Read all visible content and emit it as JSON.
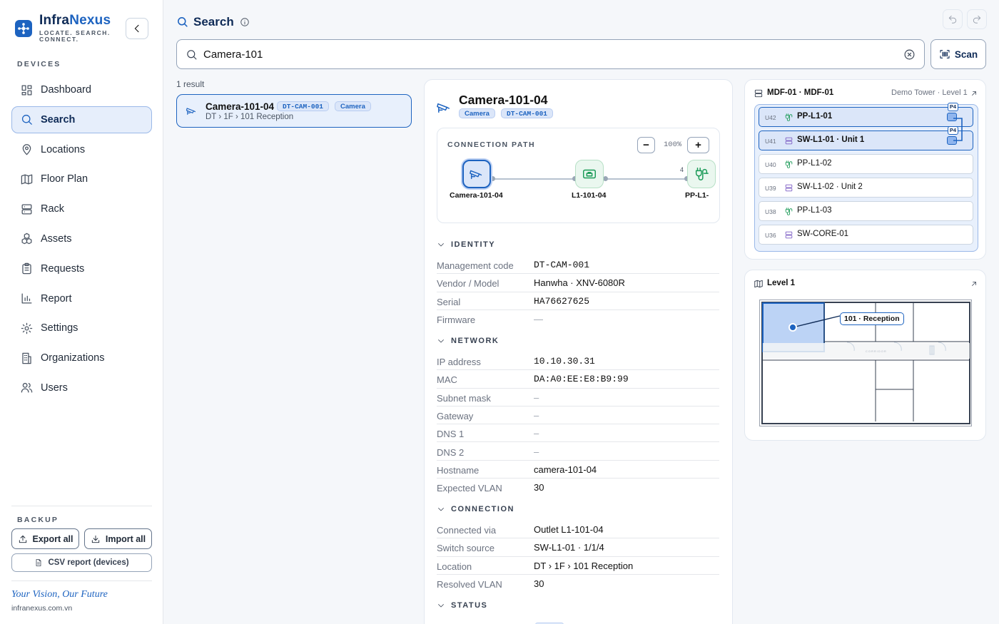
{
  "brand": {
    "name_a": "Infra",
    "name_b": "Nexus",
    "tagline": "LOCATE. SEARCH. CONNECT."
  },
  "sidebar": {
    "section": "DEVICES",
    "items": [
      {
        "label": "Dashboard",
        "icon": "dashboard-icon"
      },
      {
        "label": "Search",
        "icon": "search-icon",
        "active": true
      },
      {
        "label": "Locations",
        "icon": "map-pin-icon"
      },
      {
        "label": "Floor Plan",
        "icon": "map-icon"
      },
      {
        "label": "Rack",
        "icon": "server-icon"
      },
      {
        "label": "Assets",
        "icon": "boxes-icon"
      },
      {
        "label": "Requests",
        "icon": "clipboard-icon"
      },
      {
        "label": "Report",
        "icon": "bar-chart-icon"
      },
      {
        "label": "Settings",
        "icon": "gear-icon"
      },
      {
        "label": "Organizations",
        "icon": "building-icon"
      },
      {
        "label": "Users",
        "icon": "users-icon"
      }
    ],
    "backup": {
      "label": "BACKUP",
      "export": "Export all",
      "import": "Import all",
      "csv": "CSV report (devices)"
    },
    "slogan": "Your Vision, Our Future",
    "site": "infranexus.com.vn"
  },
  "header": {
    "title": "Search"
  },
  "search": {
    "value": "Camera-101",
    "scan_label": "Scan"
  },
  "results": {
    "count": "1 result",
    "items": [
      {
        "name": "Camera-101-04",
        "code": "DT-CAM-001",
        "type": "Camera",
        "path": "DT › 1F › 101 Reception"
      }
    ]
  },
  "detail": {
    "title": "Camera-101-04",
    "type_chip": "Camera",
    "code_chip": "DT-CAM-001",
    "connection_path": {
      "label": "CONNECTION PATH",
      "zoom": "100%",
      "nodes": [
        "Camera-101-04",
        "L1-101-04",
        "PP-L1-"
      ],
      "port_label": "4"
    },
    "identity": {
      "label": "IDENTITY",
      "rows": [
        {
          "k": "Management code",
          "v": "DT-CAM-001",
          "mono": true
        },
        {
          "k": "Vendor / Model",
          "v": "Hanwha · XNV-6080R"
        },
        {
          "k": "Serial",
          "v": "HA76627625",
          "mono": true
        },
        {
          "k": "Firmware",
          "v": "—",
          "dim": true
        }
      ]
    },
    "network": {
      "label": "NETWORK",
      "rows": [
        {
          "k": "IP address",
          "v": "10.10.30.31",
          "mono": true
        },
        {
          "k": "MAC",
          "v": "DA:A0:EE:E8:B9:99",
          "mono": true
        },
        {
          "k": "Subnet mask",
          "v": "–",
          "dim": true
        },
        {
          "k": "Gateway",
          "v": "–",
          "dim": true
        },
        {
          "k": "DNS 1",
          "v": "–",
          "dim": true
        },
        {
          "k": "DNS 2",
          "v": "–",
          "dim": true
        },
        {
          "k": "Hostname",
          "v": "camera-101-04"
        },
        {
          "k": "Expected VLAN",
          "v": "30"
        }
      ]
    },
    "connection": {
      "label": "CONNECTION",
      "rows": [
        {
          "k": "Connected via",
          "v": "Outlet L1-101-04"
        },
        {
          "k": "Switch source",
          "v": "SW-L1-01 · 1/1/4"
        },
        {
          "k": "Location",
          "v": "DT › 1F › 101 Reception"
        },
        {
          "k": "Resolved VLAN",
          "v": "30"
        }
      ]
    },
    "status": {
      "label": "STATUS"
    }
  },
  "rack": {
    "title": "MDF-01 · MDF-01",
    "subtitle": "Demo Tower · Level 1",
    "units": [
      {
        "u": "U42",
        "name": "PP-L1-01",
        "kind": "patch",
        "highlight": true,
        "port": "P4"
      },
      {
        "u": "U41",
        "name": "SW-L1-01 · Unit 1",
        "kind": "switch",
        "highlight": true,
        "port": "P4"
      },
      {
        "u": "U40",
        "name": "PP-L1-02",
        "kind": "patch"
      },
      {
        "u": "U39",
        "name": "SW-L1-02 · Unit 2",
        "kind": "switch"
      },
      {
        "u": "U38",
        "name": "PP-L1-03",
        "kind": "patch"
      },
      {
        "u": "U36",
        "name": "SW-CORE-01",
        "kind": "switch"
      }
    ]
  },
  "floor": {
    "title": "Level 1",
    "room_label": "101 · Reception",
    "corridor_label": "CORRIDOR"
  },
  "colors": {
    "accent": "#1d63c0",
    "navy": "#0f2b57",
    "green": "#1a9a57",
    "purple": "#7c5cc4"
  }
}
